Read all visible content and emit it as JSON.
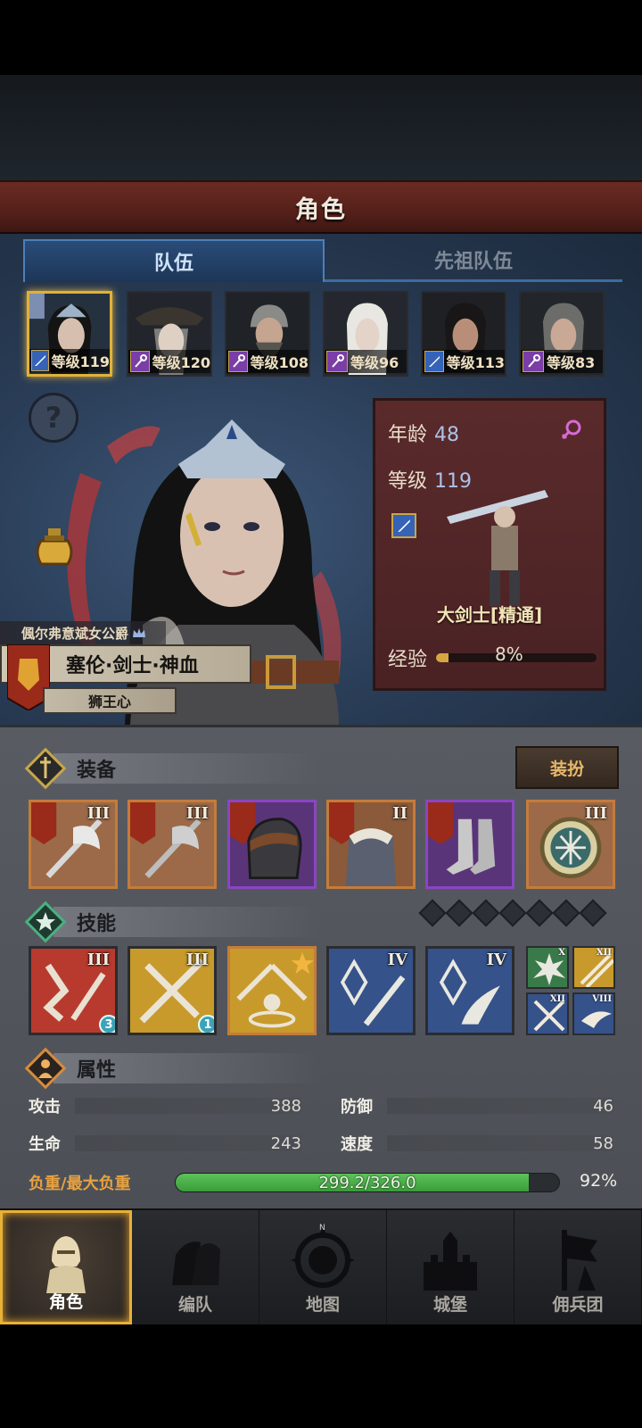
{
  "header": {
    "title": "角色"
  },
  "tabs": [
    {
      "label": "队伍",
      "active": true
    },
    {
      "label": "先祖队伍",
      "active": false
    }
  ],
  "party": [
    {
      "level": "等级119",
      "class": "sword",
      "selected": true
    },
    {
      "level": "等级120",
      "class": "staff",
      "selected": false
    },
    {
      "level": "等级108",
      "class": "staff",
      "selected": false
    },
    {
      "level": "等级96",
      "class": "staff",
      "selected": false
    },
    {
      "level": "等级113",
      "class": "sword",
      "selected": false
    },
    {
      "level": "等级83",
      "class": "staff",
      "selected": false
    }
  ],
  "character": {
    "noble_title": "偑尔弗意斌女公爵",
    "name": "塞伦·剑士·神血",
    "trait": "狮王心",
    "age_label": "年龄",
    "age": "48",
    "level_label": "等级",
    "level": "119",
    "class_name": "大剑士[精通]",
    "exp_label": "经验",
    "exp_percent_text": "8%",
    "exp_fraction": 0.08,
    "gender_icon": "female-symbol-icon"
  },
  "equipment": {
    "label": "装备",
    "dress_button": "装扮",
    "slots": [
      {
        "item": "axe",
        "tier": "III",
        "rarity": "orange"
      },
      {
        "item": "axe",
        "tier": "III",
        "rarity": "orange"
      },
      {
        "item": "helmet",
        "tier": "",
        "rarity": "purple"
      },
      {
        "item": "armor",
        "tier": "II",
        "rarity": "orange"
      },
      {
        "item": "boots",
        "tier": "",
        "rarity": "purple"
      },
      {
        "item": "amulet",
        "tier": "III",
        "rarity": "orange"
      }
    ]
  },
  "skills": {
    "label": "技能",
    "empty_slots": 7,
    "items": [
      {
        "tier": "III",
        "count": "3",
        "color": "#b83a2e"
      },
      {
        "tier": "III",
        "count": "1",
        "color": "#c79a2b"
      },
      {
        "tier": "",
        "count": "",
        "color": "#c79a2b"
      },
      {
        "tier": "IV",
        "count": "",
        "color": "#35528a"
      },
      {
        "tier": "IV",
        "count": "",
        "color": "#35528a"
      }
    ],
    "mini": [
      {
        "tier": "X",
        "color": "#3a7a4a"
      },
      {
        "tier": "XII",
        "color": "#c79a2b"
      },
      {
        "tier": "XII",
        "color": "#35528a"
      },
      {
        "tier": "VIII",
        "color": "#35528a"
      }
    ]
  },
  "attributes": {
    "label": "属性",
    "attack_label": "攻击",
    "attack": "388",
    "defense_label": "防御",
    "defense": "46",
    "hp_label": "生命",
    "hp": "243",
    "speed_label": "速度",
    "speed": "58",
    "load_label": "负重/最大负重",
    "load_text": "299.2/326.0",
    "load_percent": "92%",
    "load_fraction": 0.92
  },
  "nav": [
    {
      "label": "角色",
      "icon": "knight-helmet-icon",
      "active": true
    },
    {
      "label": "编队",
      "icon": "formation-icon",
      "active": false
    },
    {
      "label": "地图",
      "icon": "compass-map-icon",
      "active": false
    },
    {
      "label": "城堡",
      "icon": "castle-icon",
      "active": false
    },
    {
      "label": "佣兵团",
      "icon": "mercenary-banner-icon",
      "active": false
    }
  ],
  "colors": {
    "accent_gold": "#e0b13a",
    "tab_blue": "#2a4c78",
    "panel_red": "#5a2a2b",
    "load_green": "#4cb04a"
  }
}
